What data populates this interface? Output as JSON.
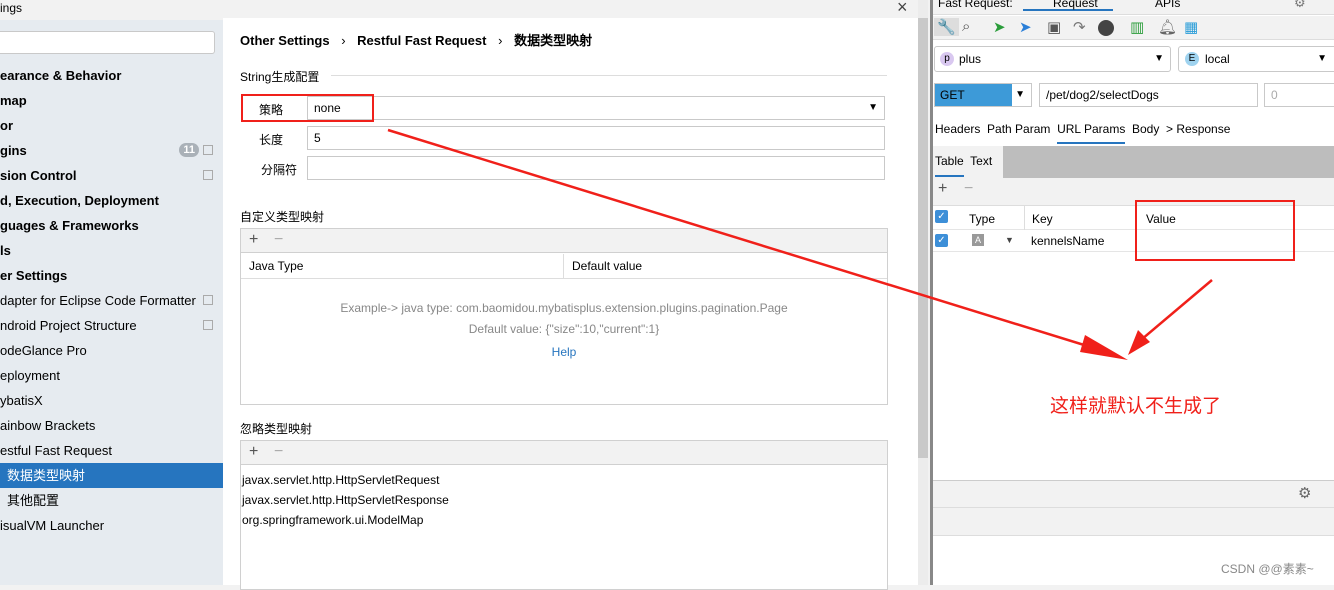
{
  "window": {
    "title": "ings",
    "close_icon": "×"
  },
  "sidebar": {
    "search_placeholder": "",
    "items": [
      {
        "label": "earance & Behavior",
        "bold": true
      },
      {
        "label": "map",
        "bold": true
      },
      {
        "label": "or",
        "bold": true
      },
      {
        "label": "gins",
        "bold": true,
        "badge": "11"
      },
      {
        "label": "sion Control",
        "bold": true
      },
      {
        "label": "d, Execution, Deployment",
        "bold": true
      },
      {
        "label": "guages & Frameworks",
        "bold": true
      },
      {
        "label": "ls",
        "bold": true
      },
      {
        "label": "er Settings",
        "bold": true
      },
      {
        "label": "dapter for Eclipse Code Formatter"
      },
      {
        "label": "ndroid Project Structure"
      },
      {
        "label": "odeGlance Pro"
      },
      {
        "label": "eployment"
      },
      {
        "label": "ybatisX"
      },
      {
        "label": "ainbow Brackets"
      },
      {
        "label": "estful Fast Request"
      },
      {
        "label": "数据类型映射",
        "selected": true
      },
      {
        "label": "其他配置"
      },
      {
        "label": "isualVM Launcher"
      }
    ]
  },
  "breadcrumb": [
    "Other Settings",
    "Restful Fast Request",
    "数据类型映射"
  ],
  "string_config": {
    "title": "String生成配置",
    "strategy_label": "策略",
    "strategy_value": "none",
    "length_label": "长度",
    "length_value": "5",
    "separator_label": "分隔符",
    "separator_value": ""
  },
  "custom_mapping": {
    "title": "自定义类型映射",
    "columns": [
      "Java Type",
      "Default value"
    ],
    "example_line1": "Example-> java type: com.baomidou.mybatisplus.extension.plugins.pagination.Page",
    "example_line2": "Default value: {\"size\":10,\"current\":1}",
    "help": "Help"
  },
  "ignore_mapping": {
    "title": "忽略类型映射",
    "items": [
      "javax.servlet.http.HttpServletRequest",
      "javax.servlet.http.HttpServletResponse",
      "org.springframework.ui.ModelMap"
    ]
  },
  "fast_request": {
    "title": "Fast Request:",
    "tabs": [
      "Request",
      "APIs"
    ],
    "project": "plus",
    "project_badge": "p",
    "env": "local",
    "env_badge": "E",
    "method": "GET",
    "url": "/pet/dog2/selectDogs",
    "count": "0",
    "subtabs": [
      "Headers",
      "Path Param",
      "URL Params",
      "Body",
      "> Response"
    ],
    "active_subtab": "URL Params",
    "view_tabs": [
      "Table",
      "Text"
    ],
    "columns": [
      "Type",
      "Key",
      "Value"
    ],
    "rows": [
      {
        "checked": true,
        "type": "A",
        "key": "kennelsName",
        "value": ""
      }
    ]
  },
  "annotation": {
    "text": "这样就默认不生成了",
    "color": "#f0201a"
  },
  "watermark": "CSDN @@素素~",
  "colors": {
    "accent": "#2675bf",
    "highlight": "#f0201a",
    "method": "#3d9ad8"
  }
}
